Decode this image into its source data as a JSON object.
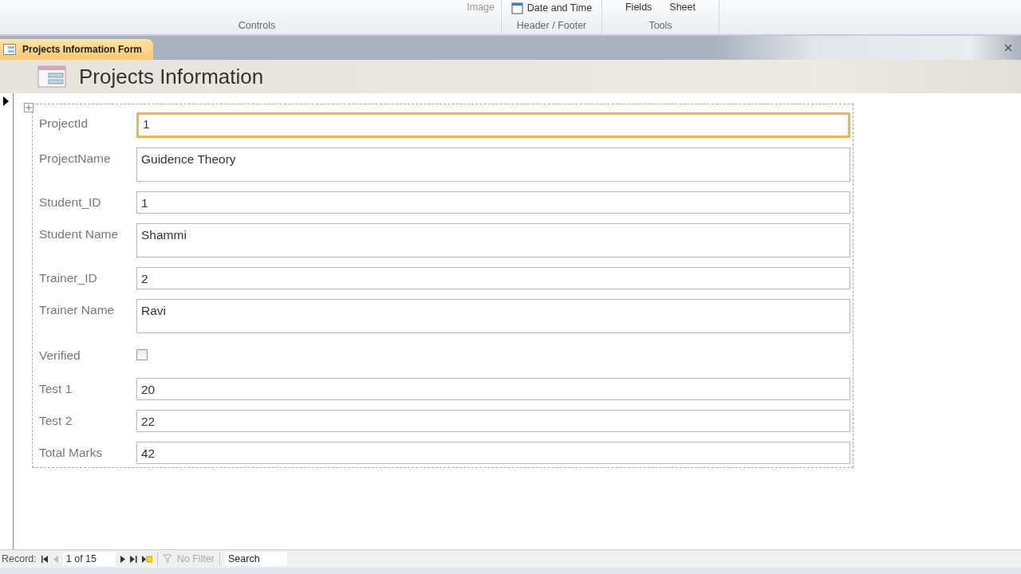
{
  "ribbon": {
    "groups": [
      {
        "label": "Controls",
        "items": [
          "Image"
        ]
      },
      {
        "label": "Header / Footer",
        "items": [
          "Date and Time"
        ]
      },
      {
        "label": "Tools",
        "items": [
          "Fields",
          "Sheet"
        ]
      }
    ]
  },
  "document_tab": {
    "label": "Projects Information Form",
    "selected": true
  },
  "form": {
    "title": "Projects Information",
    "fields": [
      {
        "label": "ProjectId",
        "kind": "text",
        "value": "1",
        "focused": true
      },
      {
        "label": "ProjectName",
        "kind": "memo",
        "value": "Guidence Theory",
        "focused": false
      },
      {
        "label": "Student_ID",
        "kind": "text",
        "value": "1",
        "focused": false
      },
      {
        "label": "Student Name",
        "kind": "memo",
        "value": "Shammi",
        "focused": false
      },
      {
        "label": "Trainer_ID",
        "kind": "text",
        "value": "2",
        "focused": false
      },
      {
        "label": "Trainer Name",
        "kind": "memo",
        "value": "Ravi",
        "focused": false
      },
      {
        "label": "Verified",
        "kind": "checkbox",
        "checked": false,
        "focused": false
      },
      {
        "label": "Test 1",
        "kind": "text",
        "value": "20",
        "focused": false
      },
      {
        "label": "Test 2",
        "kind": "text",
        "value": "22",
        "focused": false
      },
      {
        "label": "Total Marks",
        "kind": "text",
        "value": "42",
        "focused": false
      }
    ]
  },
  "navigation": {
    "label": "Record:",
    "position": "1 of 15",
    "filter": "No Filter",
    "search": "Search"
  }
}
